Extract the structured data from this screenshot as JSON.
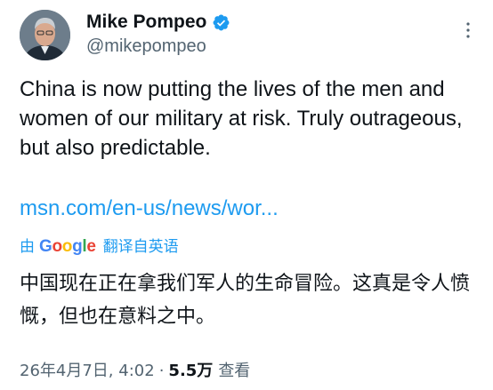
{
  "author": {
    "name": "Mike Pompeo",
    "handle": "@mikepompeo",
    "verified": true,
    "avatar_icon": "profile-photo"
  },
  "tweet": {
    "text": "China is now putting the lives of the men and women of our military at risk. Truly outrageous, but also predictable.",
    "link_text": "msn.com/en-us/news/wor..."
  },
  "translation": {
    "by_label": "由",
    "provider": "Google",
    "label": "翻译自英语",
    "text": "中国现在正在拿我们军人的生命冒险。这真是令人愤慨，但也在意料之中。"
  },
  "meta": {
    "timestamp": "26年4月7日, 4:02",
    "separator": "·",
    "views_count": "5.5万",
    "views_label": "查看"
  },
  "colors": {
    "link": "#1d9bf0",
    "verified": "#1d9bf0",
    "secondary_text": "#536471",
    "primary_text": "#0f1419"
  }
}
